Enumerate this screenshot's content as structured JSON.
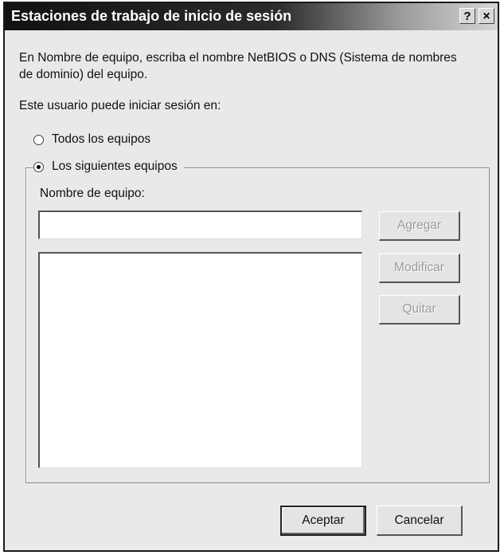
{
  "window": {
    "title": "Estaciones de trabajo de inicio de sesión",
    "help_label": "?",
    "close_label": "×"
  },
  "content": {
    "description": "En Nombre de equipo, escriba el nombre NetBIOS o DNS (Sistema de nombres de dominio) del equipo.",
    "logon_label": "Este usuario puede iniciar sesión en:",
    "option_all": "Todos los equipos",
    "option_following": "Los siguientes equipos",
    "selected_option": "Los siguientes equipos",
    "computer_name_label": "Nombre de equipo:",
    "computer_name_value": "",
    "computer_list": []
  },
  "buttons": {
    "add": "Agregar",
    "modify": "Modificar",
    "remove": "Quitar",
    "ok": "Aceptar",
    "cancel": "Cancelar"
  }
}
